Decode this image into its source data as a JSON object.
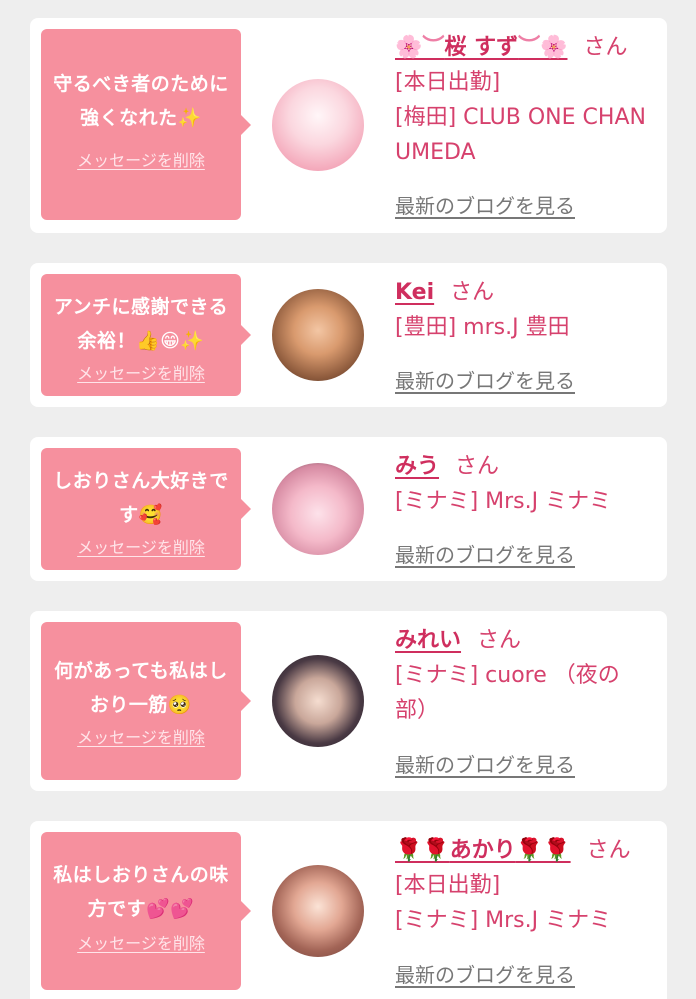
{
  "messages": [
    {
      "text": "守るべき者のために強くなれた✨",
      "delete_label": "メッセージを削除",
      "name_prefix": "🌸︶",
      "name": "桜 すず",
      "name_suffix": "︶🌸",
      "honorific": "さん",
      "status": "[本日出勤]",
      "shop": "[梅田] CLUB ONE CHAN UMEDA",
      "blog_label": "最新のブログを見る"
    },
    {
      "text": "アンチに感謝できる余裕！👍😁✨",
      "delete_label": "メッセージを削除",
      "name_prefix": "",
      "name": "Kei",
      "name_suffix": "",
      "honorific": "さん",
      "status": "",
      "shop": "[豊田] mrs.J 豊田",
      "blog_label": "最新のブログを見る"
    },
    {
      "text": "しおりさん大好きです🥰",
      "delete_label": "メッセージを削除",
      "name_prefix": "",
      "name": "みう",
      "name_suffix": "",
      "honorific": "さん",
      "status": "",
      "shop": "[ミナミ] Mrs.J ミナミ",
      "blog_label": "最新のブログを見る"
    },
    {
      "text": "何があっても私はしおり一筋🥺",
      "delete_label": "メッセージを削除",
      "name_prefix": "",
      "name": "みれい",
      "name_suffix": "",
      "honorific": "さん",
      "status": "",
      "shop": "[ミナミ] cuore （夜の部）",
      "blog_label": "最新のブログを見る"
    },
    {
      "text": "私はしおりさんの味方です💕💕",
      "delete_label": "メッセージを削除",
      "name_prefix": "🌹🌹",
      "name": "あかり",
      "name_suffix": "🌹🌹",
      "honorific": "さん",
      "status": "[本日出勤]",
      "shop": "[ミナミ] Mrs.J ミナミ",
      "blog_label": "最新のブログを見る"
    }
  ],
  "colors": {
    "bubble": "#f6909e",
    "name": "#cf2e5e",
    "text": "#d6416d",
    "link": "#777777",
    "background": "#eeeeee"
  }
}
